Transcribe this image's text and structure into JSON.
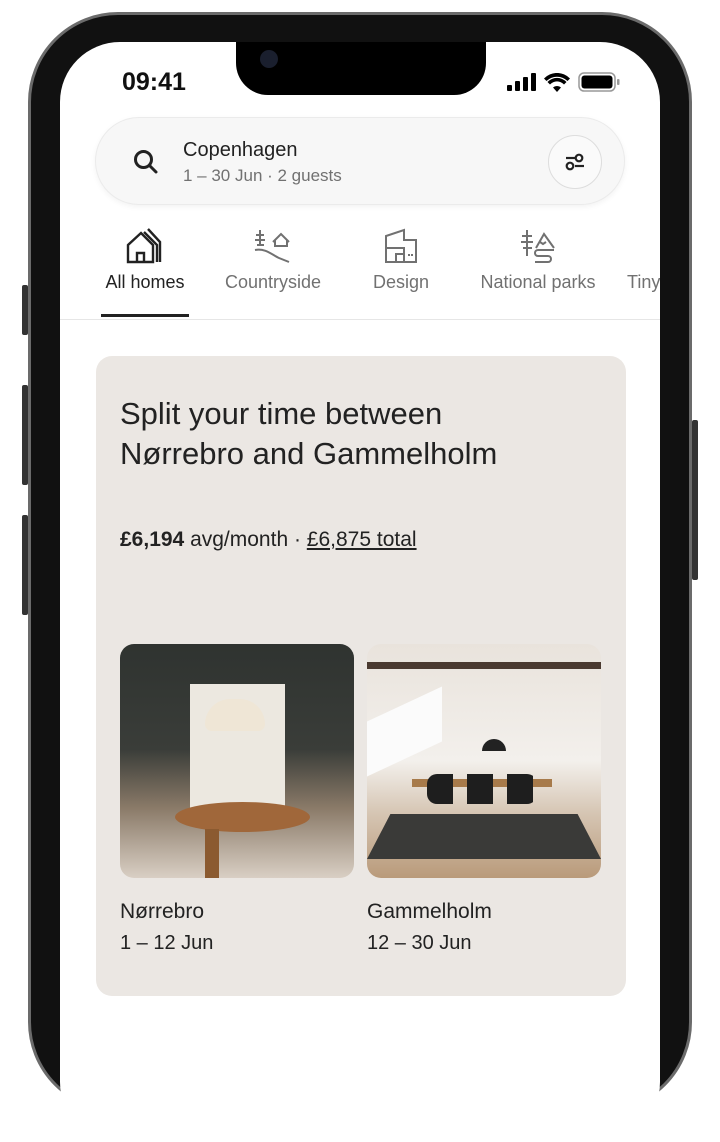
{
  "status": {
    "time": "09:41"
  },
  "search": {
    "location": "Copenhagen",
    "details": "1 – 30 Jun · 2 guests"
  },
  "categories": [
    {
      "label": "All homes",
      "icon": "houses-icon",
      "active": true
    },
    {
      "label": "Countryside",
      "icon": "countryside-icon"
    },
    {
      "label": "Design",
      "icon": "design-building-icon"
    },
    {
      "label": "National parks",
      "icon": "national-park-icon"
    },
    {
      "label": "Tiny"
    }
  ],
  "card": {
    "title": "Split your time between Nørrebro and Gammelholm",
    "price": "£6,194",
    "price_suffix": " avg/month · ",
    "total": "£6,875 total",
    "stays": [
      {
        "name": "Nørrebro",
        "dates": "1 – 12 Jun"
      },
      {
        "name": "Gammelholm",
        "dates": "12 – 30 Jun"
      }
    ]
  },
  "colors": {
    "card_bg": "#ebe7e3",
    "text": "#222222",
    "muted": "#717171"
  }
}
